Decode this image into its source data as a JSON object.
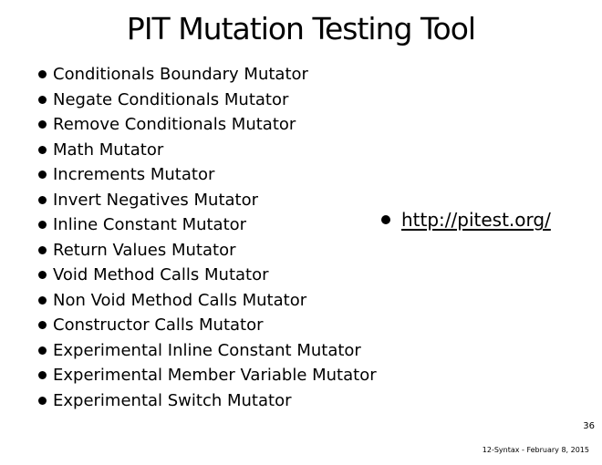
{
  "slide": {
    "title": "PIT Mutation Testing Tool",
    "mutators": [
      "Conditionals Boundary Mutator",
      "Negate Conditionals Mutator",
      "Remove Conditionals Mutator",
      "Math Mutator",
      "Increments Mutator",
      "Invert Negatives Mutator",
      "Inline Constant Mutator",
      "Return Values Mutator",
      "Void Method Calls Mutator",
      "Non Void Method Calls Mutator",
      "Constructor Calls Mutator",
      "Experimental Inline Constant Mutator",
      "Experimental Member Variable Mutator",
      "Experimental Switch Mutator"
    ],
    "link": "http://pitest.org/",
    "page_number": "36",
    "footer": "12-Syntax - February 8, 2015"
  }
}
